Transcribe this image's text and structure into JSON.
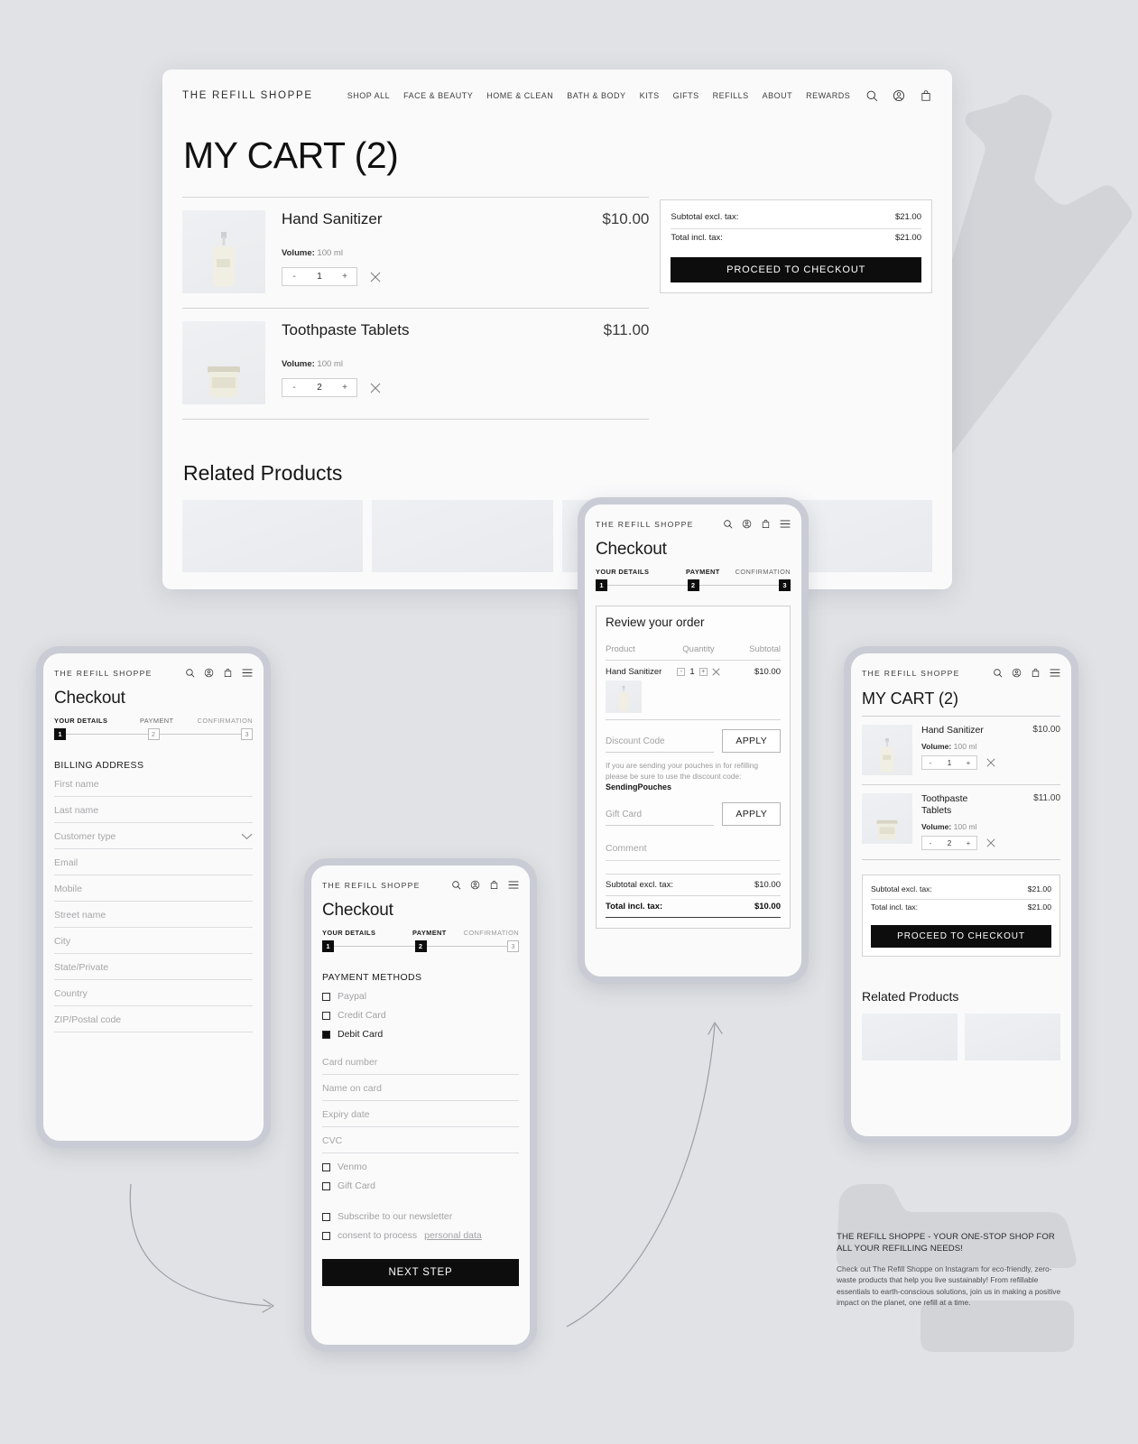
{
  "brand": "THE REFILL SHOPPE",
  "desktop": {
    "nav_links": [
      "SHOP ALL",
      "FACE & BEAUTY",
      "HOME & CLEAN",
      "BATH & BODY",
      "KITS",
      "GIFTS",
      "REFILLS",
      "ABOUT",
      "REWARDS"
    ],
    "icons": [
      "search-icon",
      "account-icon",
      "bag-icon"
    ],
    "page_title": "MY CART (2)",
    "items": [
      {
        "name": "Hand Sanitizer",
        "price": "$10.00",
        "volume_label": "Volume:",
        "volume_value": "100 ml",
        "qty": "1",
        "minus": "-",
        "plus": "+",
        "remove": "✕"
      },
      {
        "name": "Toothpaste Tablets",
        "price": "$11.00",
        "volume_label": "Volume:",
        "volume_value": "100 ml",
        "qty": "2",
        "minus": "-",
        "plus": "+",
        "remove": "✕"
      }
    ],
    "summary": {
      "subtotal_label": "Subtotal excl. tax:",
      "subtotal_value": "$21.00",
      "total_label": "Total incl. tax:",
      "total_value": "$21.00",
      "checkout_button": "PROCEED TO CHECKOUT"
    },
    "related_title": "Related Products"
  },
  "phone_billing": {
    "title": "Checkout",
    "steps": [
      {
        "label": "YOUR DETAILS",
        "num": "1",
        "active": true
      },
      {
        "label": "PAYMENT",
        "num": "2",
        "active": false
      },
      {
        "label": "CONFIRMATION",
        "num": "3",
        "active": false
      }
    ],
    "section": "BILLING ADDRESS",
    "fields": [
      {
        "placeholder": "First name",
        "dropdown": false
      },
      {
        "placeholder": "Last name",
        "dropdown": false
      },
      {
        "placeholder": "Customer type",
        "dropdown": true
      },
      {
        "placeholder": "Email",
        "dropdown": false
      },
      {
        "placeholder": "Mobile",
        "dropdown": false
      },
      {
        "placeholder": "Street name",
        "dropdown": false
      },
      {
        "placeholder": "City",
        "dropdown": false
      },
      {
        "placeholder": "State/Private",
        "dropdown": false
      },
      {
        "placeholder": "Country",
        "dropdown": false
      },
      {
        "placeholder": "ZIP/Postal code",
        "dropdown": false
      }
    ]
  },
  "phone_payment": {
    "title": "Checkout",
    "steps": [
      {
        "label": "YOUR DETAILS",
        "num": "1",
        "active": true
      },
      {
        "label": "PAYMENT",
        "num": "2",
        "active": true
      },
      {
        "label": "CONFIRMATION",
        "num": "3",
        "active": false
      }
    ],
    "section": "PAYMENT METHODS",
    "methods_top": [
      {
        "label": "Paypal",
        "checked": false
      },
      {
        "label": "Credit Card",
        "checked": false
      },
      {
        "label": "Debit Card",
        "checked": true
      }
    ],
    "card_fields": [
      "Card number",
      "Name on card",
      "Expiry date",
      "CVC"
    ],
    "methods_bottom": [
      {
        "label": "Venmo",
        "checked": false
      },
      {
        "label": "Gift Card",
        "checked": false
      }
    ],
    "consents": [
      {
        "label": "Subscribe to our newsletter",
        "checked": false,
        "link": ""
      },
      {
        "label": "consent to process ",
        "checked": false,
        "link": "personal data"
      }
    ],
    "next_button": "NEXT STEP"
  },
  "phone_review": {
    "title": "Checkout",
    "steps": [
      {
        "label": "YOUR DETAILS",
        "num": "1",
        "active": true
      },
      {
        "label": "PAYMENT",
        "num": "2",
        "active": true
      },
      {
        "label": "CONFIRMATION",
        "num": "3",
        "active": true
      }
    ],
    "card_title": "Review your order",
    "columns": {
      "product": "Product",
      "quantity": "Quantity",
      "subtotal": "Subtotal"
    },
    "item": {
      "name": "Hand Sanitizer",
      "minus": "-",
      "qty": "1",
      "plus": "+",
      "remove": "✕",
      "subtotal": "$10.00"
    },
    "discount_placeholder": "Discount Code",
    "discount_apply": "APPLY",
    "note_text": "If you are sending your pouches in for refilling please be sure to use the discount code: ",
    "note_code": "SendingPouches",
    "giftcard_placeholder": "Gift Card",
    "giftcard_apply": "APPLY",
    "comment_placeholder": "Comment",
    "subtotal_label": "Subtotal excl. tax:",
    "subtotal_value": "$10.00",
    "total_label": "Total incl. tax:",
    "total_value": "$10.00"
  },
  "phone_cart": {
    "page_title": "MY CART (2)",
    "items": [
      {
        "name": "Hand Sanitizer",
        "price": "$10.00",
        "volume_label": "Volume:",
        "volume_value": "100 ml",
        "qty": "1",
        "minus": "-",
        "plus": "+",
        "remove": "✕"
      },
      {
        "name": "Toothpaste Tablets",
        "price": "$11.00",
        "volume_label": "Volume:",
        "volume_value": "100 ml",
        "qty": "2",
        "minus": "-",
        "plus": "+",
        "remove": "✕"
      }
    ],
    "summary": {
      "subtotal_label": "Subtotal excl. tax:",
      "subtotal_value": "$21.00",
      "total_label": "Total incl. tax:",
      "total_value": "$21.00",
      "checkout_button": "PROCEED TO CHECKOUT"
    },
    "related_title": "Related Products"
  },
  "promo": {
    "heading": "THE REFILL SHOPPE - YOUR ONE-STOP SHOP FOR ALL YOUR REFILLING NEEDS!",
    "body": "Check out The Refill Shoppe on Instagram for eco-friendly, zero-waste products that help you live sustainably! From refillable essentials to earth-conscious solutions, join us in making a positive impact on the planet, one refill at a time."
  },
  "colors": {
    "canvas": "#e0e2e5",
    "surface": "#fafafb",
    "accent_black": "#0d0d0d",
    "phone_frame": "#c9ccd4",
    "muted_text": "#9a9a9c"
  }
}
